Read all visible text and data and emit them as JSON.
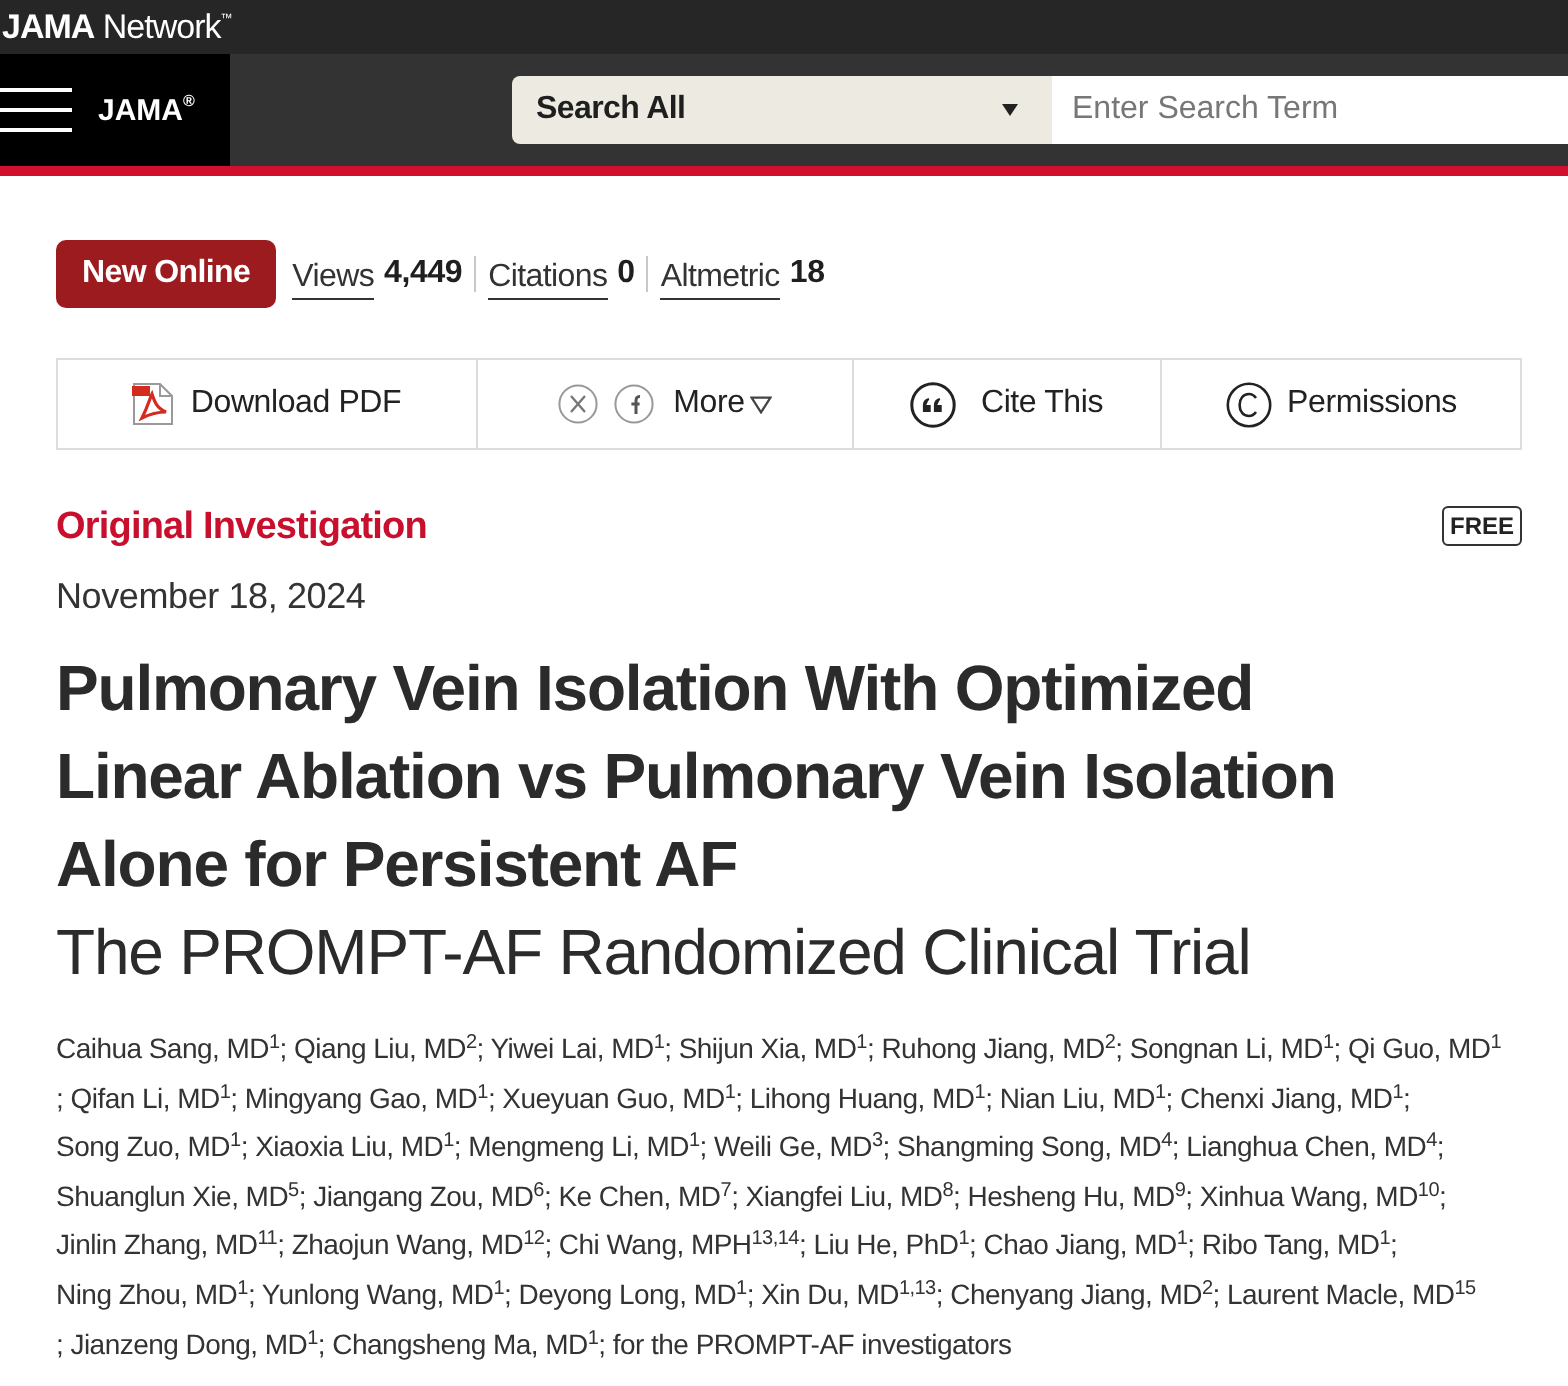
{
  "header": {
    "brand": "**JAMA** Network$^{™}$"
  },
  "navbar": {
    "journal": "JAMA$^{®}$",
    "search": {
      "scope": "Search All",
      "placeholder": "Enter Search Term"
    }
  },
  "article": {
    "badge": "New Online",
    "metrics": [
      {
        "label": "Views",
        "value": "4,449"
      },
      {
        "label": "Citations",
        "value": "0"
      },
      {
        "label": "Altmetric",
        "value": "18"
      }
    ],
    "toolbar": [
      {
        "kind": "pdf",
        "label": "Download PDF"
      },
      {
        "kind": "share",
        "label": "More"
      },
      {
        "kind": "cite",
        "label": "Cite This"
      },
      {
        "kind": "permissions",
        "label": "Permissions"
      }
    ],
    "category": "Original Investigation",
    "access": "FREE",
    "date": "November 18, 2024",
    "title": "Pulmonary Vein Isolation With Optimized Linear Ablation vs Pulmonary Vein Isolation Alone for Persistent AF",
    "subtitle": "The PROMPT-AF Randomized Clinical Trial",
    "author_lines": [
      "Caihua Sang, MD$^{1}$; Qiang Liu, MD$^{2}$; Yiwei Lai, MD$^{1}$; Shijun Xia, MD$^{1}$; Ruhong Jiang, MD$^{2}$; Songnan Li, MD$^{1}$; Qi Guo, MD$^{1}$",
      "; Qifan Li, MD$^{1}$; Mingyang Gao, MD$^{1}$; Xueyuan Guo, MD$^{1}$; Lihong Huang, MD$^{1}$; Nian Liu, MD$^{1}$; Chenxi Jiang, MD$^{1}$;",
      "Song Zuo, MD$^{1}$; Xiaoxia Liu, MD$^{1}$; Mengmeng Li, MD$^{1}$; Weili Ge, MD$^{3}$; Shangming Song, MD$^{4}$; Lianghua Chen, MD$^{4}$;",
      "Shuanglun Xie, MD$^{5}$; Jiangang Zou, MD$^{6}$; Ke Chen, MD$^{7}$; Xiangfei Liu, MD$^{8}$; Hesheng Hu, MD$^{9}$; Xinhua Wang, MD$^{10}$;",
      "Jinlin Zhang, MD$^{11}$; Zhaojun Wang, MD$^{12}$; Chi Wang, MPH$^{13,14}$; Liu He, PhD$^{1}$; Chao Jiang, MD$^{1}$; Ribo Tang, MD$^{1}$;",
      "Ning Zhou, MD$^{1}$; Yunlong Wang, MD$^{1}$; Deyong Long, MD$^{1}$; Xin Du, MD$^{1,13}$; Chenyang Jiang, MD$^{2}$; Laurent Macle, MD$^{15}$",
      "; Jianzeng Dong, MD$^{1}$; Changsheng Ma, MD$^{1}$; for the PROMPT-AF investigators"
    ]
  }
}
